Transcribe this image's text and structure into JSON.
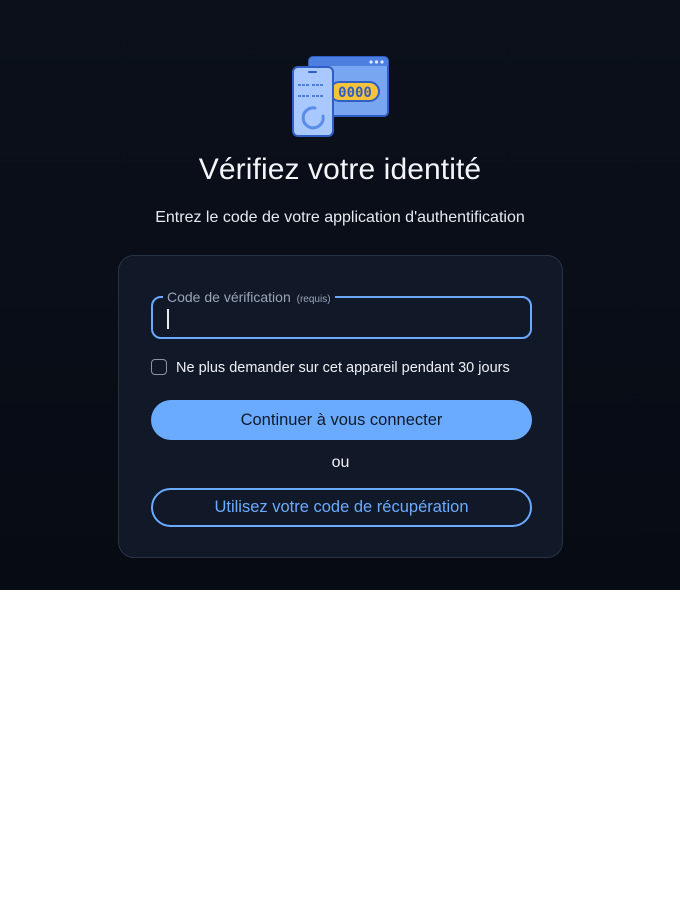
{
  "header": {
    "illustration_icon": "phone-and-code-window-icon",
    "illustration_code": "0000",
    "title": "Vérifiez votre identité",
    "subtitle": "Entrez le code de votre application d'authentification"
  },
  "form": {
    "code_field": {
      "label": "Code de vérification",
      "required_hint": "(requis)",
      "value": ""
    },
    "remember_device": {
      "label": "Ne plus demander sur cet appareil pendant 30 jours",
      "checked": false
    },
    "primary_button": "Continuer à vous connecter",
    "separator": "ou",
    "secondary_button": "Utilisez votre code de récupération"
  },
  "colors": {
    "background": "#0b101b",
    "card": "#111827",
    "accent": "#6aabff",
    "text": "#eef1f6"
  }
}
